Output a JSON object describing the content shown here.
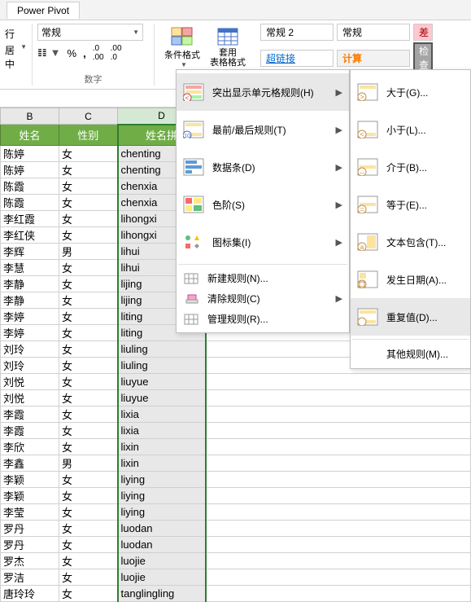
{
  "tab": "Power Pivot",
  "ribbon": {
    "alignment": {
      "row1": "行"
    },
    "center_label": "居中 ",
    "number_format": "常规",
    "group_number_label": "数字",
    "cond_format_label": "条件格式",
    "table_format_label": "套用\n表格格式",
    "style_normal2": "常规 2",
    "style_normal": "常规",
    "style_bad": "差",
    "style_hyperlink": "超链接",
    "style_calc": "计算",
    "style_check": "检查"
  },
  "columns": [
    "B",
    "C",
    "D"
  ],
  "headers": {
    "b": "姓名",
    "c": "性别",
    "d": "姓名拼"
  },
  "rows": [
    {
      "b": "陈婷",
      "c": "女",
      "d": "chenting"
    },
    {
      "b": "陈婷",
      "c": "女",
      "d": "chenting"
    },
    {
      "b": "陈霞",
      "c": "女",
      "d": "chenxia"
    },
    {
      "b": "陈霞",
      "c": "女",
      "d": "chenxia"
    },
    {
      "b": "李红霞",
      "c": "女",
      "d": "lihongxi"
    },
    {
      "b": "李红侠",
      "c": "女",
      "d": "lihongxi"
    },
    {
      "b": "李辉",
      "c": "男",
      "d": "lihui"
    },
    {
      "b": "李慧",
      "c": "女",
      "d": "lihui"
    },
    {
      "b": "李静",
      "c": "女",
      "d": "lijing"
    },
    {
      "b": "李静",
      "c": "女",
      "d": "lijing"
    },
    {
      "b": "李婷",
      "c": "女",
      "d": "liting"
    },
    {
      "b": "李婷",
      "c": "女",
      "d": "liting"
    },
    {
      "b": "刘玲",
      "c": "女",
      "d": "liuling"
    },
    {
      "b": "刘玲",
      "c": "女",
      "d": "liuling"
    },
    {
      "b": "刘悦",
      "c": "女",
      "d": "liuyue"
    },
    {
      "b": "刘悦",
      "c": "女",
      "d": "liuyue"
    },
    {
      "b": "李霞",
      "c": "女",
      "d": "lixia"
    },
    {
      "b": "李霞",
      "c": "女",
      "d": "lixia"
    },
    {
      "b": "李欣",
      "c": "女",
      "d": "lixin"
    },
    {
      "b": "李鑫",
      "c": "男",
      "d": "lixin"
    },
    {
      "b": "李颖",
      "c": "女",
      "d": "liying"
    },
    {
      "b": "李颖",
      "c": "女",
      "d": "liying"
    },
    {
      "b": "李莹",
      "c": "女",
      "d": "liying"
    },
    {
      "b": "罗丹",
      "c": "女",
      "d": "luodan"
    },
    {
      "b": "罗丹",
      "c": "女",
      "d": "luodan"
    },
    {
      "b": "罗杰",
      "c": "女",
      "d": "luojie"
    },
    {
      "b": "罗洁",
      "c": "女",
      "d": "luojie"
    },
    {
      "b": "唐玲玲",
      "c": "女",
      "d": "tanglingling"
    }
  ],
  "menu1": {
    "highlight": "突出显示单元格规则(H)",
    "toplast": "最前/最后规则(T)",
    "databar": "数据条(D)",
    "colorscale": "色阶(S)",
    "iconset": "图标集(I)",
    "new": "新建规则(N)...",
    "clear": "清除规则(C)",
    "manage": "管理规则(R)..."
  },
  "menu2": {
    "gt": "大于(G)...",
    "lt": "小于(L)...",
    "between": "介于(B)...",
    "eq": "等于(E)...",
    "text": "文本包含(T)...",
    "date": "发生日期(A)...",
    "dup": "重复值(D)...",
    "other": "其他规则(M)..."
  }
}
